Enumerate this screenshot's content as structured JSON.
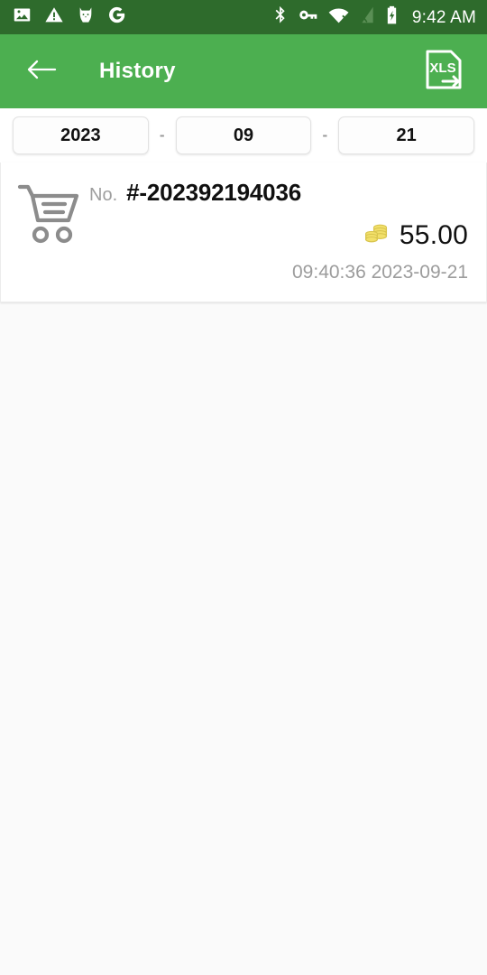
{
  "status_bar": {
    "background_color": "#2e6b2c",
    "time": "9:42 AM",
    "left_icons": [
      {
        "name": "image-icon"
      },
      {
        "name": "warning-triangle-icon"
      },
      {
        "name": "cat-face-icon"
      },
      {
        "name": "google-g-icon"
      }
    ],
    "right_icons": [
      {
        "name": "bluetooth-icon"
      },
      {
        "name": "vpn-key-icon"
      },
      {
        "name": "wifi-off-icon"
      },
      {
        "name": "signal-no-sim-icon"
      },
      {
        "name": "battery-charging-icon"
      }
    ]
  },
  "app_bar": {
    "background_color": "#4caf50",
    "title": "History",
    "back_icon": "arrow-left-icon",
    "export_icon": "xls-export-icon",
    "export_label": "XLS"
  },
  "date_selector": {
    "year": "2023",
    "month": "09",
    "day": "21",
    "separator": "-"
  },
  "records": [
    {
      "icon": "shopping-cart-icon",
      "no_label": "No.",
      "no_value": "#-202392194036",
      "amount_icon": "coins-icon",
      "amount": "55.00",
      "amount_color": "#111111",
      "timestamp": "09:40:36 2023-09-21"
    }
  ]
}
